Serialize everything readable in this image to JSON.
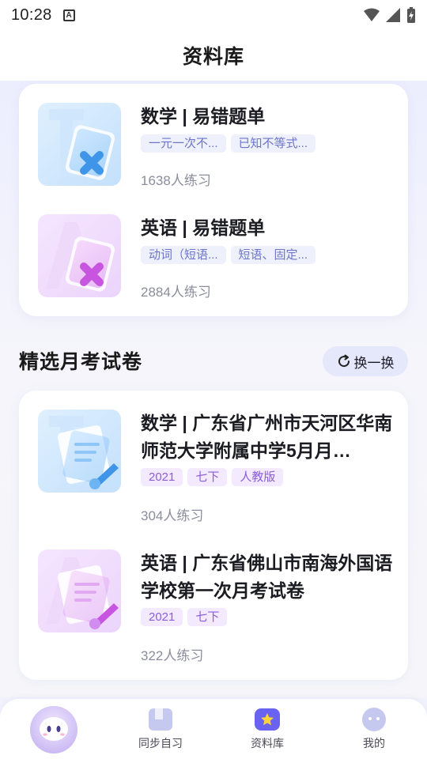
{
  "status_bar": {
    "time": "10:28",
    "notification_icon": "A"
  },
  "nav": {
    "title": "资料库"
  },
  "mistakes": [
    {
      "title": "数学 | 易错题单",
      "tags": [
        "一元一次不...",
        "已知不等式..."
      ],
      "count": "1638人练习",
      "icon": "math-mistakes-icon"
    },
    {
      "title": "英语 | 易错题单",
      "tags": [
        "动词（短语...",
        "短语、固定..."
      ],
      "count": "2884人练习",
      "icon": "english-mistakes-icon"
    }
  ],
  "exams_section": {
    "title": "精选月考试卷",
    "refresh_label": "换一换"
  },
  "exams": [
    {
      "title": "数学 | 广东省广州市天河区华南师范大学附属中学5月月…",
      "tags": [
        "2021",
        "七下",
        "人教版"
      ],
      "count": "304人练习",
      "icon": "math-exam-icon"
    },
    {
      "title": "英语 | 广东省佛山市南海外国语学校第一次月考试卷",
      "tags": [
        "2021",
        "七下"
      ],
      "count": "322人练习",
      "icon": "english-exam-icon"
    }
  ],
  "tabbar": {
    "items": [
      {
        "label": "",
        "icon": "assistant-avatar-icon"
      },
      {
        "label": "同步自习",
        "icon": "book-icon"
      },
      {
        "label": "资料库",
        "icon": "library-star-icon",
        "active": true
      },
      {
        "label": "我的",
        "icon": "profile-face-icon"
      }
    ]
  },
  "colors": {
    "accent": "#6a62f0",
    "tag_blue_text": "#6c75c8",
    "tag_purple_text": "#8b5ed6"
  }
}
